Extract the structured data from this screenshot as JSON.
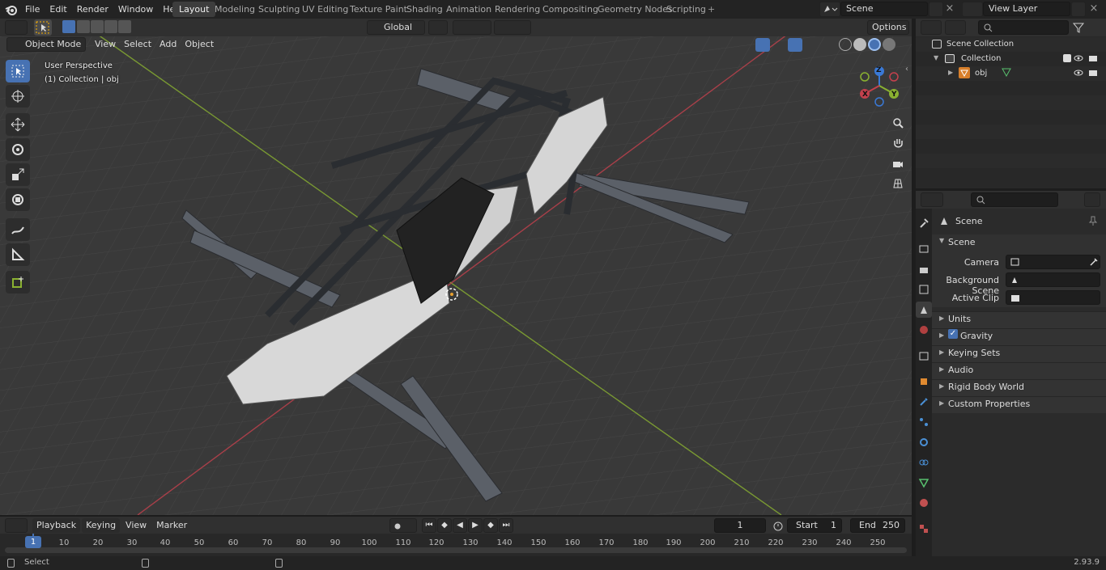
{
  "menus": [
    "File",
    "Edit",
    "Render",
    "Window",
    "Help"
  ],
  "workspaces": [
    "Layout",
    "Modeling",
    "Sculpting",
    "UV Editing",
    "Texture Paint",
    "Shading",
    "Animation",
    "Rendering",
    "Compositing",
    "Geometry Nodes",
    "Scripting"
  ],
  "scene_name": "Scene",
  "view_layer": "View Layer",
  "viewport": {
    "mode": "Object Mode",
    "menus": [
      "View",
      "Select",
      "Add",
      "Object"
    ],
    "orientation": "Global",
    "options": "Options",
    "perspective": "User Perspective",
    "collection": "(1) Collection | obj"
  },
  "outliner": {
    "root": "Scene Collection",
    "collection": "Collection",
    "object": "obj"
  },
  "properties": {
    "header": "Scene",
    "panel": "Scene",
    "camera_label": "Camera",
    "bg_scene_label": "Background Scene",
    "active_clip_label": "Active Clip",
    "sections": [
      "Units",
      "Gravity",
      "Keying Sets",
      "Audio",
      "Rigid Body World",
      "Custom Properties"
    ]
  },
  "timeline": {
    "menus": [
      "Playback",
      "Keying",
      "View",
      "Marker"
    ],
    "current_frame": "1",
    "start_label": "Start",
    "start": "1",
    "end_label": "End",
    "end": "250",
    "ticks": [
      "10",
      "20",
      "30",
      "40",
      "50",
      "60",
      "70",
      "80",
      "90",
      "100",
      "110",
      "120",
      "130",
      "140",
      "150",
      "160",
      "170",
      "180",
      "190",
      "200",
      "210",
      "220",
      "230",
      "240",
      "250"
    ],
    "frame_marker": "1"
  },
  "status": {
    "select": "Select",
    "version": "2.93.9"
  },
  "gizmo": {
    "x": "X",
    "y": "Y",
    "z": "Z"
  },
  "colors": {
    "accent": "#4772b3",
    "x_axis": "#c4414d",
    "y_axis": "#8ab131",
    "z_axis": "#3a79d6",
    "timeline_frame": "#4772b3"
  }
}
